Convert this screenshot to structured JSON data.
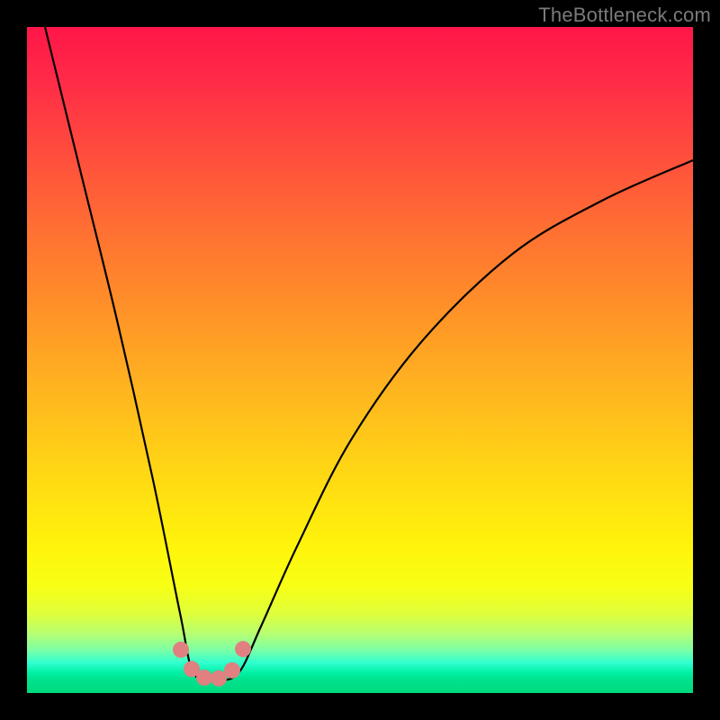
{
  "watermark": "TheBottleneck.com",
  "chart_data": {
    "type": "line",
    "title": "",
    "xlabel": "",
    "ylabel": "",
    "x_range": [
      0,
      740
    ],
    "y_range_pct": [
      0,
      100
    ],
    "curve": {
      "left_start": {
        "x": 20,
        "y_pct": 100
      },
      "valley_start_x": 185,
      "valley_end_x": 235,
      "valley_y_pct": 2,
      "right_end": {
        "x": 740,
        "y_pct": 80
      }
    },
    "series": [
      {
        "name": "bottleneck-curve",
        "description": "V-shaped curve: steep descent from top-left to a flat valley near x≈185–235 at ~2% height, then a convex rise toward the right reaching ~80% height at the right edge.",
        "points": [
          {
            "x": 20,
            "y_pct": 100
          },
          {
            "x": 60,
            "y_pct": 78
          },
          {
            "x": 100,
            "y_pct": 56
          },
          {
            "x": 140,
            "y_pct": 32
          },
          {
            "x": 170,
            "y_pct": 12
          },
          {
            "x": 185,
            "y_pct": 3
          },
          {
            "x": 210,
            "y_pct": 2
          },
          {
            "x": 235,
            "y_pct": 3
          },
          {
            "x": 260,
            "y_pct": 10
          },
          {
            "x": 300,
            "y_pct": 22
          },
          {
            "x": 360,
            "y_pct": 38
          },
          {
            "x": 440,
            "y_pct": 53
          },
          {
            "x": 540,
            "y_pct": 66
          },
          {
            "x": 640,
            "y_pct": 74
          },
          {
            "x": 740,
            "y_pct": 80
          }
        ]
      }
    ],
    "markers": [
      {
        "x": 171,
        "y_pct": 6.5
      },
      {
        "x": 183,
        "y_pct": 3.6
      },
      {
        "x": 197,
        "y_pct": 2.3
      },
      {
        "x": 213,
        "y_pct": 2.2
      },
      {
        "x": 228,
        "y_pct": 3.4
      },
      {
        "x": 240,
        "y_pct": 6.6
      }
    ],
    "marker_color": "#e08080",
    "marker_radius": 9,
    "curve_stroke": "#000000",
    "curve_width": 2.2
  }
}
